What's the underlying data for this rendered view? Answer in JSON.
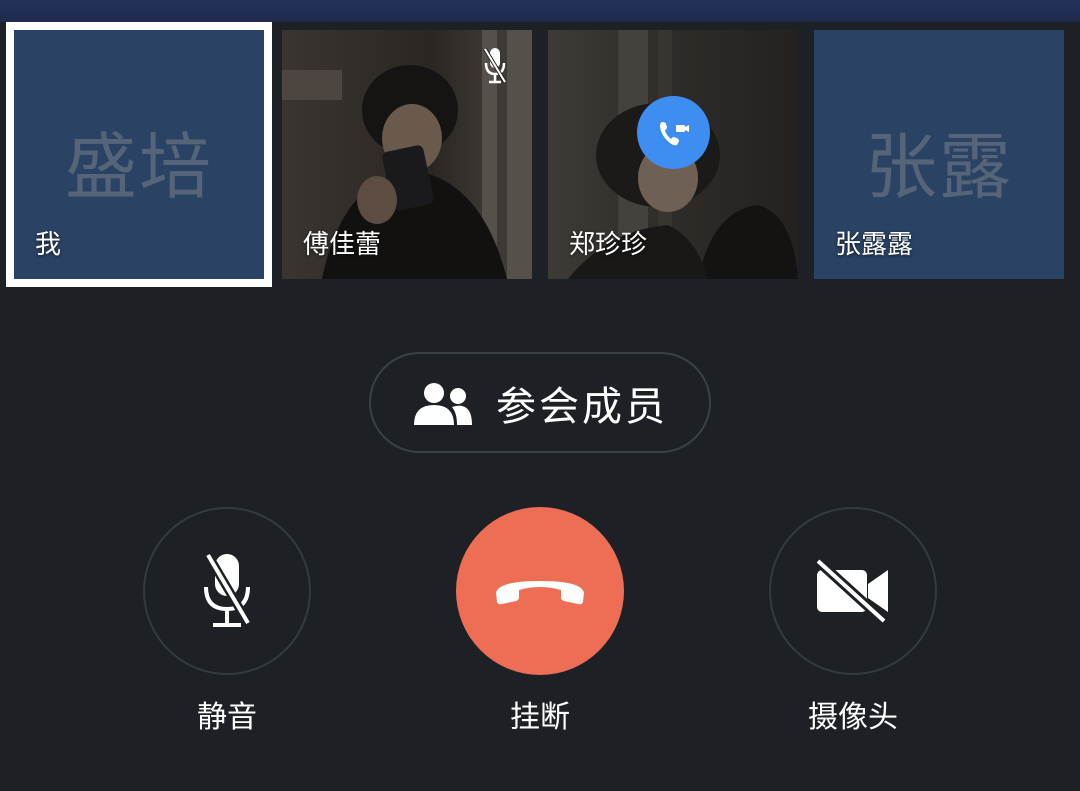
{
  "participants": [
    {
      "name": "我",
      "initials": "盛培",
      "type": "avatar",
      "selected": true
    },
    {
      "name": "傅佳蕾",
      "type": "video",
      "muted": true
    },
    {
      "name": "郑珍珍",
      "type": "video",
      "calling": true
    },
    {
      "name": "张露露",
      "initials": "张露",
      "type": "avatar"
    }
  ],
  "members_button": {
    "label": "参会成员",
    "icon": "people-icon"
  },
  "controls": {
    "mute": {
      "label": "静音",
      "icon": "mic-off-icon"
    },
    "hangup": {
      "label": "挂断",
      "icon": "phone-hangup-icon",
      "color": "#ed6e55"
    },
    "camera": {
      "label": "摄像头",
      "icon": "camera-off-icon"
    }
  },
  "colors": {
    "background": "#1d2126",
    "avatar_tile": "#2a4264",
    "call_badge": "#3d8ef0",
    "hangup": "#ed6e55"
  }
}
